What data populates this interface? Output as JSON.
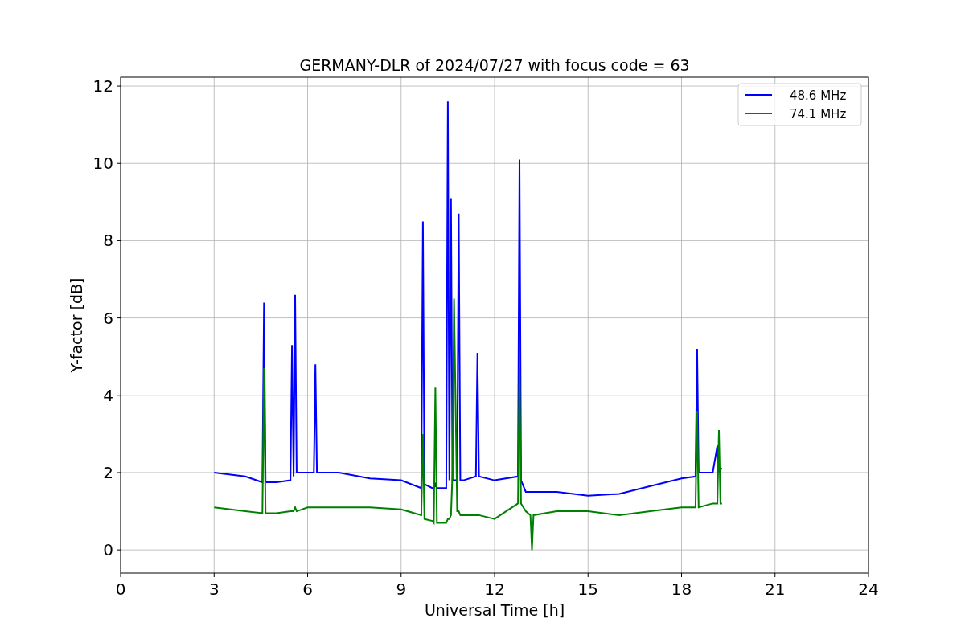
{
  "figure": {
    "chart_data": {
      "type": "line",
      "grid": true,
      "legend": true,
      "title": "GERMANY-DLR of 2024/07/27 with focus code = 63",
      "xlabel": "Universal Time [h]",
      "ylabel": "Y-factor [dB]",
      "xlim": [
        0,
        24
      ],
      "ylim": [
        -0.6,
        12.23
      ],
      "xticks": [
        0,
        3,
        6,
        9,
        12,
        15,
        18,
        21,
        24
      ],
      "yticks": [
        0,
        2,
        4,
        6,
        8,
        10,
        12
      ],
      "x": [
        3,
        4,
        4.55,
        4.6,
        4.65,
        5,
        5.45,
        5.5,
        5.55,
        5.6,
        5.65,
        6,
        6.2,
        6.25,
        6.3,
        7,
        8,
        9,
        9.65,
        9.7,
        9.75,
        10,
        10.05,
        10.1,
        10.15,
        10.45,
        10.5,
        10.55,
        10.6,
        10.65,
        10.7,
        10.8,
        10.85,
        10.9,
        11,
        11.4,
        11.45,
        11.5,
        12,
        12.75,
        12.8,
        12.85,
        13,
        13.15,
        13.2,
        13.25,
        14,
        15,
        16,
        17,
        18,
        18.45,
        18.5,
        18.55,
        19,
        19.15,
        19.2,
        19.25,
        19.3
      ],
      "series": [
        {
          "name": "48.6 MHz",
          "color": "#0000ff",
          "values": [
            2.0,
            1.9,
            1.75,
            6.4,
            1.75,
            1.75,
            1.8,
            5.3,
            1.9,
            6.6,
            2.0,
            2.0,
            2.0,
            4.8,
            2.0,
            2.0,
            1.85,
            1.8,
            1.6,
            8.5,
            1.7,
            1.6,
            1.6,
            1.7,
            1.6,
            1.6,
            11.6,
            1.8,
            9.1,
            1.8,
            1.8,
            1.8,
            8.7,
            1.8,
            1.8,
            1.9,
            5.1,
            1.9,
            1.8,
            1.9,
            10.1,
            1.8,
            1.5,
            1.5,
            1.5,
            1.5,
            1.5,
            1.4,
            1.45,
            1.65,
            1.85,
            1.9,
            5.2,
            2.0,
            2.0,
            2.7,
            2.0,
            2.1,
            2.1
          ]
        },
        {
          "name": "74.1 MHz",
          "color": "#008000",
          "values": [
            1.1,
            1.0,
            0.95,
            4.7,
            0.95,
            0.95,
            1.0,
            1.0,
            1.0,
            1.1,
            1.0,
            1.1,
            1.1,
            1.1,
            1.1,
            1.1,
            1.1,
            1.05,
            0.9,
            3.0,
            0.8,
            0.75,
            0.7,
            4.2,
            0.7,
            0.7,
            0.8,
            0.8,
            0.9,
            2.0,
            6.5,
            1.0,
            1.0,
            0.9,
            0.9,
            0.9,
            0.9,
            0.9,
            0.8,
            1.2,
            4.7,
            1.2,
            1.0,
            0.9,
            0.0,
            0.9,
            1.0,
            1.0,
            0.9,
            1.0,
            1.1,
            1.1,
            3.6,
            1.1,
            1.2,
            1.2,
            3.1,
            1.2,
            1.2
          ]
        }
      ]
    }
  }
}
